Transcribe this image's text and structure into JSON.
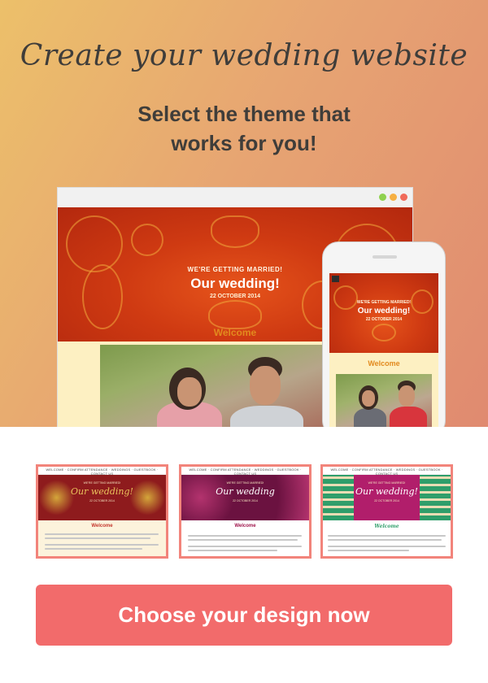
{
  "hero": {
    "title": "Create your wedding website",
    "subtitle": "Select the theme that works for you!"
  },
  "desktop_preview": {
    "window_dots": [
      "#8fd14f",
      "#f6b042",
      "#f06a5a"
    ],
    "eyebrow": "WE'RE GETTING MARRIED!",
    "heading": "Our wedding!",
    "date": "22 OCTOBER 2014",
    "welcome": "Welcome"
  },
  "phone_preview": {
    "eyebrow": "WE'RE GETTING MARRIED!",
    "heading": "Our wedding!",
    "date": "22 OCTOBER 2014",
    "welcome": "Welcome"
  },
  "themes": [
    {
      "nav": "WELCOME · CONFIRM ATTENDANCE · WEDDINGS · GUESTBOOK · CONTACT US",
      "eyebrow": "WE'RE GETTING MARRIED!",
      "heading": "Our wedding!",
      "date": "22 OCTOBER 2014",
      "welcome": "Welcome",
      "banner_color": "#8e1b1d",
      "accent_color": "#d4a63a",
      "welcome_color": "#c4372d"
    },
    {
      "nav": "WELCOME · CONFIRM ATTENDANCE · WEDDINGS · GUESTBOOK · CONTACT US",
      "eyebrow": "WE'RE GETTING MARRIED!",
      "heading": "Our wedding",
      "date": "22 OCTOBER 2014",
      "welcome": "Welcome",
      "banner_color": "#6b1240",
      "accent_color": "#b3336e",
      "welcome_color": "#a0174d"
    },
    {
      "nav": "WELCOME · CONFIRM ATTENDANCE · WEDDINGS · GUESTBOOK · CONTACT US",
      "eyebrow": "WE'RE GETTING MARRIED!",
      "heading": "Our wedding!",
      "date": "22 OCTOBER 2014",
      "welcome": "Welcome",
      "banner_color": "#b11e6b",
      "accent_color": "#2f9e6a",
      "welcome_color": "#2f9e6a"
    }
  ],
  "cta": {
    "label": "Choose your design now",
    "color": "#f26b6b"
  }
}
